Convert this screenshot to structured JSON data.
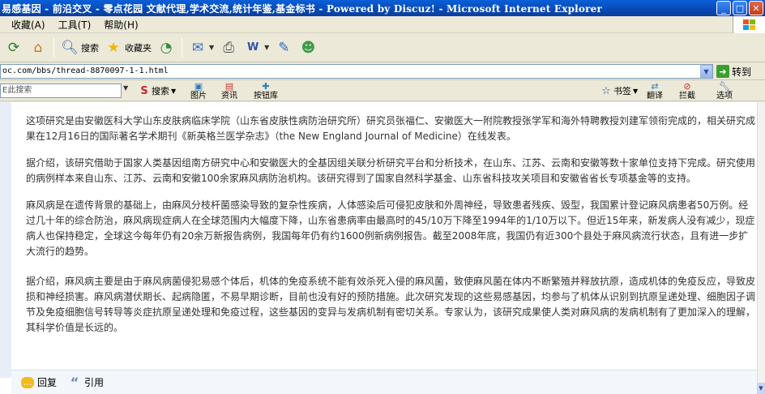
{
  "window": {
    "title": "易感基因 - 前沿交叉 - 零点花园 文献代理,学术交流,统计年鉴,基金标书 - Powered by Discuz! - Microsoft Internet Explorer",
    "controls": [
      "minimize",
      "maximize",
      "close"
    ]
  },
  "menu": {
    "items": [
      "收藏(A)",
      "工具(T)",
      "帮助(H)"
    ]
  },
  "toolbar": {
    "search_label": "搜索",
    "favorites_label": "收藏夹"
  },
  "address": {
    "url": "oc.com/bbs/thread-8870097-1-1.html",
    "go_label": "转到"
  },
  "searchbar": {
    "placeholder": "E此搜索",
    "search_label": "搜索",
    "images_label": "图片",
    "news_label": "资讯",
    "buttons_label": "按钮库",
    "bookmarks_label": "书签",
    "translate_label": "翻译",
    "block_label": "拦截",
    "options_label": "选项"
  },
  "post": {
    "paragraphs": [
      "这项研究是由安徽医科大学山东皮肤病临床学院（山东省皮肤性病防治研究所）研究员张福仁、安徽医大一附院教授张学军和海外特聘教授刘建军领衔完成的，相关研究成果在12月16日的国际著名学术期刊《新英格兰医学杂志》（the New England Journal of Medicine）在线发表。",
      "据介绍，该研究借助于国家人类基因组南方研究中心和安徽医大的全基因组关联分析研究平台和分析技术，在山东、江苏、云南和安徽等数十家单位支持下完成。研究使用的病例样本来自山东、江苏、云南和安徽100余家麻风病防治机构。该研究得到了国家自然科学基金、山东省科技攻关项目和安徽省省长专项基金等的支持。",
      "麻风病是在遗传背景的基础上，由麻风分枝杆菌感染导致的复杂性疾病，人体感染后可侵犯皮肤和外周神经，导致患者残疾、毁型，我国累计登记麻风病患者50万例。经过几十年的综合防治，麻风病现症病人在全球范围内大幅度下降，山东省患病率由最高时的45/10万下降至1994年的1/10万以下。但近15年来，新发病人没有减少，现症病人也保持稳定，全球这今每年仍有20余万新报告病例，我国每年仍有约1600例新病例报告。截至2008年底，我国仍有近300个县处于麻风病流行状态，且有进一步扩大流行的趋势。",
      "据介绍，麻风病主要是由于麻风病菌侵犯易感个体后，机体的免疫系统不能有效杀死入侵的麻风菌，致使麻风菌在体内不断繁殖并释放抗原，造成机体的免疫反应，导致皮损和神经损害。麻风病潜伏期长、起病隐匿，不易早期诊断，目前也没有好的预防措施。此次研究发现的这些易感基因，均参与了机体从识别到抗原呈递处理、细胞因子调节及免疫细胞信号转导等炎症抗原呈递处理和免疫过程，这些基因的变异与发病机制有密切关系。专家认为，该研究成果使人类对麻风病的发病机制有了更加深入的理解，其科学价值是长远的。"
    ],
    "actions": {
      "reply_label": "回复",
      "quote_label": "引用"
    }
  }
}
